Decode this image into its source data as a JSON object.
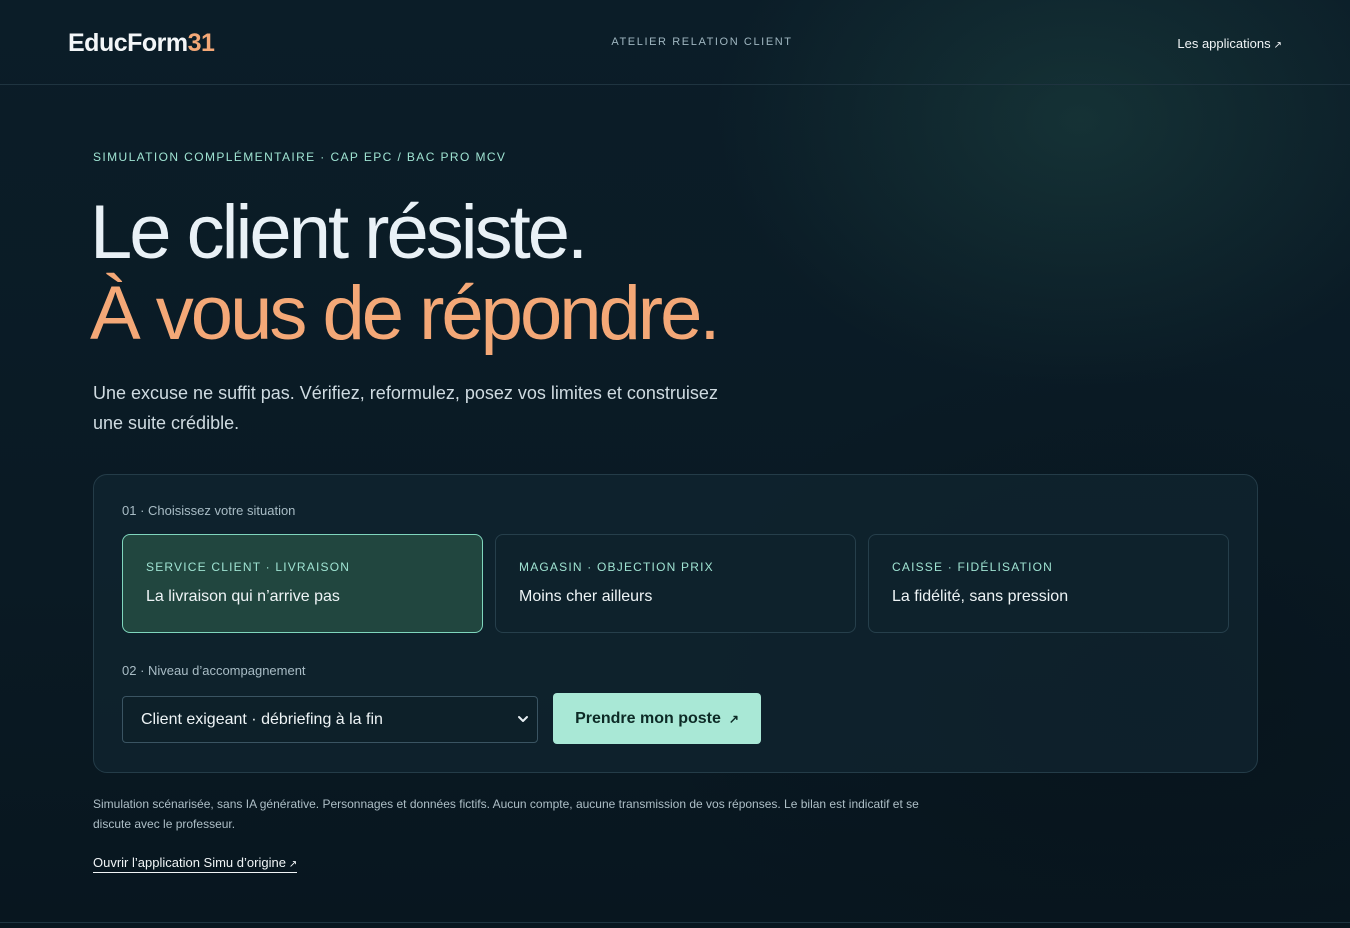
{
  "header": {
    "logo_main": "EducForm",
    "logo_accent": "31",
    "center_title": "ATELIER RELATION CLIENT",
    "apps_link": "Les applications",
    "apps_link_icon": "↗"
  },
  "hero": {
    "eyebrow": "SIMULATION COMPLÉMENTAIRE · CAP EPC / BAC PRO MCV",
    "line1": "Le client résiste.",
    "line2": "À vous de répondre.",
    "lead": "Une excuse ne suffit pas. Vérifiez, reformulez, posez vos limites et construisez une suite crédible."
  },
  "panel": {
    "step1_label": "01 · Choisissez votre situation",
    "cards": [
      {
        "tag": "SERVICE CLIENT · LIVRAISON",
        "title": "La livraison qui n’arrive pas",
        "selected": true
      },
      {
        "tag": "MAGASIN · OBJECTION PRIX",
        "title": "Moins cher ailleurs",
        "selected": false
      },
      {
        "tag": "CAISSE · FIDÉLISATION",
        "title": "La fidélité, sans pression",
        "selected": false
      }
    ],
    "step2_label": "02 · Niveau d’accompagnement",
    "select_value": "Client exigeant · débriefing à la fin",
    "cta_label": "Prendre mon poste",
    "cta_icon": "↗"
  },
  "footer": {
    "disclaimer": "Simulation scénarisée, sans IA générative. Personnages et données fictifs. Aucun compte, aucune transmission de vos réponses. Le bilan est indicatif et se discute avec le professeur.",
    "origin_link": "Ouvrir l’application Simu d’origine",
    "origin_link_icon": "↗"
  },
  "colors": {
    "background": "#0a1a24",
    "accent_orange": "#f4a877",
    "accent_mint": "#9fe3d2",
    "cta_bg": "#a9e8d6",
    "selected_card_bg": "#21463f"
  }
}
